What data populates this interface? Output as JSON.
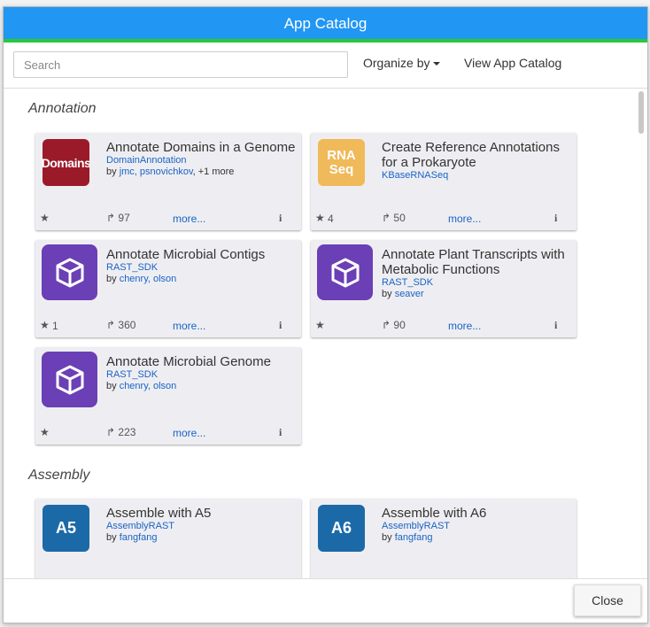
{
  "window": {
    "title": "App Catalog"
  },
  "toolbar": {
    "search_placeholder": "Search",
    "organize_label": "Organize by",
    "view_catalog_label": "View App Catalog"
  },
  "sections": [
    {
      "title": "Annotation"
    },
    {
      "title": "Assembly"
    }
  ],
  "cards": [
    {
      "title": "Annotate Domains in a Genome",
      "module": "DomainAnnotation",
      "by": "by",
      "authors": "jmc, psnovichkov",
      "extra": ", +1 more",
      "stars": "",
      "runs": "97",
      "more": "more...",
      "icon_text": "Domains"
    },
    {
      "title": "Create Reference Annotations for a Prokaryote",
      "module": "KBaseRNASeq",
      "by": "",
      "authors": "",
      "extra": "",
      "stars": "4",
      "runs": "50",
      "more": "more...",
      "icon_text_1": "RNA",
      "icon_text_2": "Seq"
    },
    {
      "title": "Annotate Microbial Contigs",
      "module": "RAST_SDK",
      "by": "by",
      "authors": "chenry, olson",
      "extra": "",
      "stars": "1",
      "runs": "360",
      "more": "more..."
    },
    {
      "title": "Annotate Plant Transcripts with Metabolic Functions",
      "module": "RAST_SDK",
      "by": "by",
      "authors": "seaver",
      "extra": "",
      "stars": "",
      "runs": "90",
      "more": "more..."
    },
    {
      "title": "Annotate Microbial Genome",
      "module": "RAST_SDK",
      "by": "by",
      "authors": "chenry, olson",
      "extra": "",
      "stars": "",
      "runs": "223",
      "more": "more..."
    },
    {
      "title": "Assemble with A5",
      "module": "AssemblyRAST",
      "by": "by",
      "authors": "fangfang",
      "extra": "",
      "icon_text": "A5"
    },
    {
      "title": "Assemble with A6",
      "module": "AssemblyRAST",
      "by": "by",
      "authors": "fangfang",
      "extra": "",
      "icon_text": "A6"
    }
  ],
  "footer": {
    "close_label": "Close"
  },
  "colors": {
    "header": "#2196f3",
    "header_accent": "#2ac838",
    "link": "#1a63c5"
  }
}
